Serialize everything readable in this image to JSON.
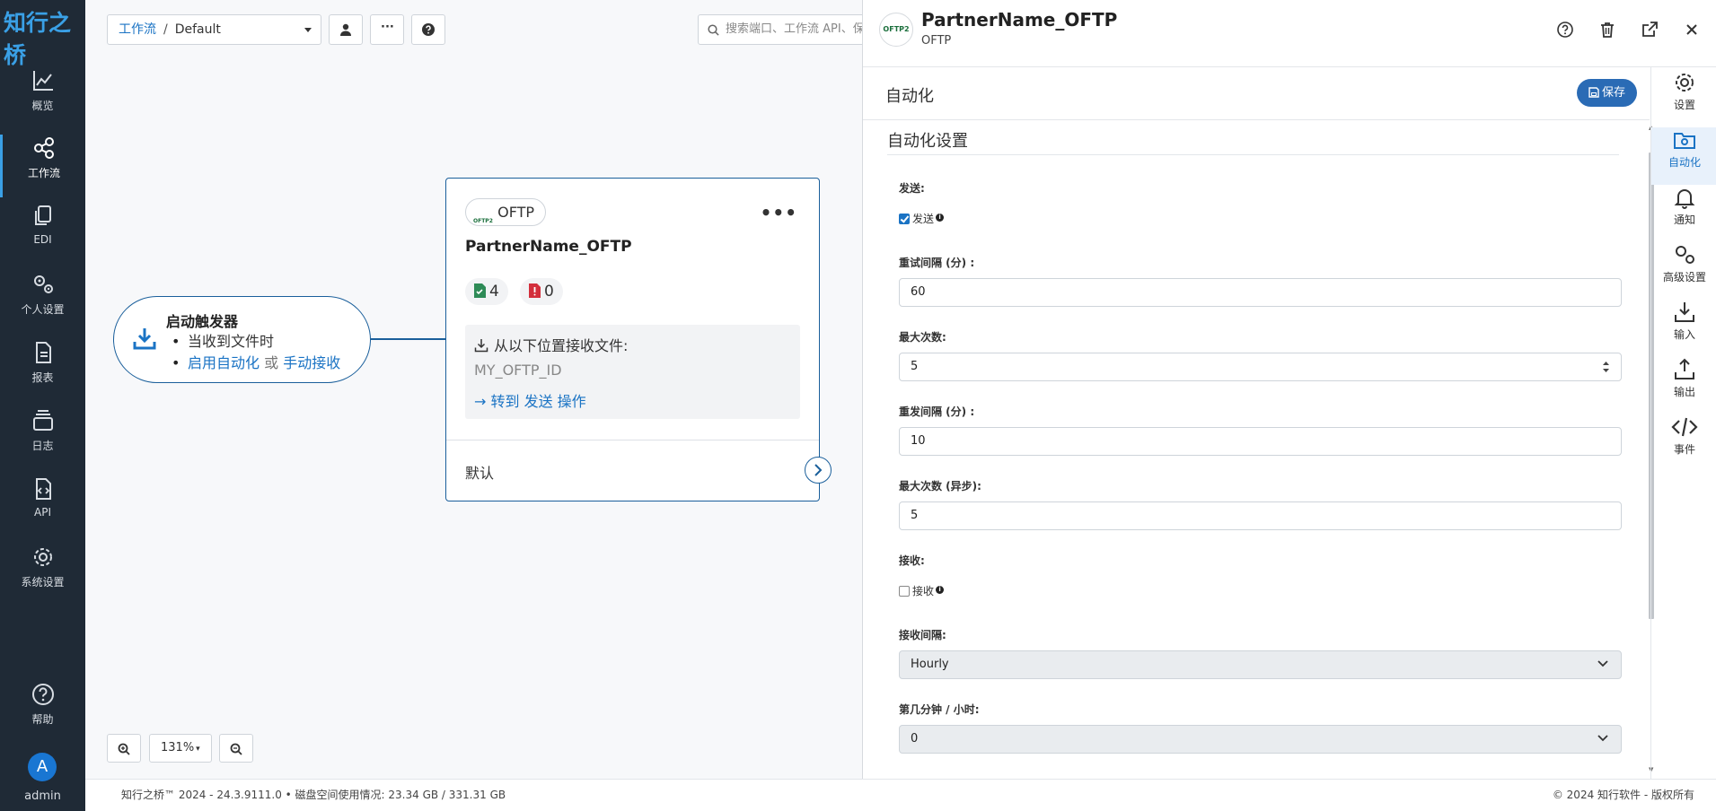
{
  "app": {
    "logo": "知行之桥"
  },
  "nav": {
    "items": [
      {
        "label": "概览",
        "icon": "chart-line-icon"
      },
      {
        "label": "工作流",
        "icon": "share-nodes-icon",
        "active": true
      },
      {
        "label": "EDI",
        "icon": "copy-icon"
      },
      {
        "label": "个人设置",
        "icon": "gears-icon"
      },
      {
        "label": "报表",
        "icon": "file-icon"
      },
      {
        "label": "日志",
        "icon": "layers-icon"
      },
      {
        "label": "API",
        "icon": "file-code-icon"
      },
      {
        "label": "系统设置",
        "icon": "gear-icon"
      }
    ],
    "help": "帮助",
    "avatar_letter": "A",
    "user": "admin"
  },
  "toolbar": {
    "breadcrumb_link": "工作流",
    "breadcrumb_sep": "/",
    "breadcrumb_current": "Default",
    "more_label": "···",
    "search_placeholder": "搜索端口、工作流 API、保"
  },
  "canvas": {
    "trigger": {
      "title": "启动触发器",
      "line1": "当收到文件时",
      "line2_a": "启用自动化",
      "line2_or": "或",
      "line2_b": "手动接收"
    },
    "card": {
      "type_label": "OFTP",
      "logo_text": "OFTP2",
      "more": "•••",
      "title": "PartnerName_OFTP",
      "success_count": "4",
      "error_count": "0",
      "receive_label": "从以下位置接收文件:",
      "receive_id": "MY_OFTP_ID",
      "goto_label": "→ 转到 发送 操作",
      "default_label": "默认"
    },
    "zoom": {
      "level": "131%",
      "caret": "▾"
    }
  },
  "footer": {
    "left": "知行之桥™ 2024 - 24.3.9111.0  •  磁盘空间使用情况:  23.34 GB / 331.31 GB",
    "right": "© 2024 知行软件 - 版权所有"
  },
  "panel": {
    "logo_text": "OFTP2",
    "title": "PartnerName_OFTP",
    "subtitle": "OFTP",
    "section_title": "自动化",
    "save_label": "保存",
    "form_heading": "自动化设置",
    "fields": {
      "send_label": "发送:",
      "send_checkbox": "发送",
      "send_checked": true,
      "retry_interval_label": "重试间隔 (分) :",
      "retry_interval_value": "60",
      "max_attempts_label": "最大次数:",
      "max_attempts_value": "5",
      "resend_interval_label": "重发间隔 (分) :",
      "resend_interval_value": "10",
      "max_attempts_async_label": "最大次数 (异步):",
      "max_attempts_async_value": "5",
      "receive_label": "接收:",
      "receive_checkbox": "接收",
      "receive_checked": false,
      "receive_interval_label": "接收间隔:",
      "receive_interval_value": "Hourly",
      "minute_label": "第几分钟 / 小时:",
      "minute_value": "0"
    },
    "tabs": [
      {
        "label": "设置",
        "icon": "gear-icon"
      },
      {
        "label": "自动化",
        "icon": "folder-gear-icon",
        "active": true
      },
      {
        "label": "通知",
        "icon": "bell-icon"
      },
      {
        "label": "高级设置",
        "icon": "gears-icon"
      },
      {
        "label": "输入",
        "icon": "download-icon"
      },
      {
        "label": "输出",
        "icon": "upload-icon"
      },
      {
        "label": "事件",
        "icon": "code-icon"
      }
    ]
  },
  "colors": {
    "nav_bg": "#1f2a36",
    "accent": "#1a73c4",
    "node_border": "#1a5f9b",
    "save_button": "#2a6bb5"
  }
}
